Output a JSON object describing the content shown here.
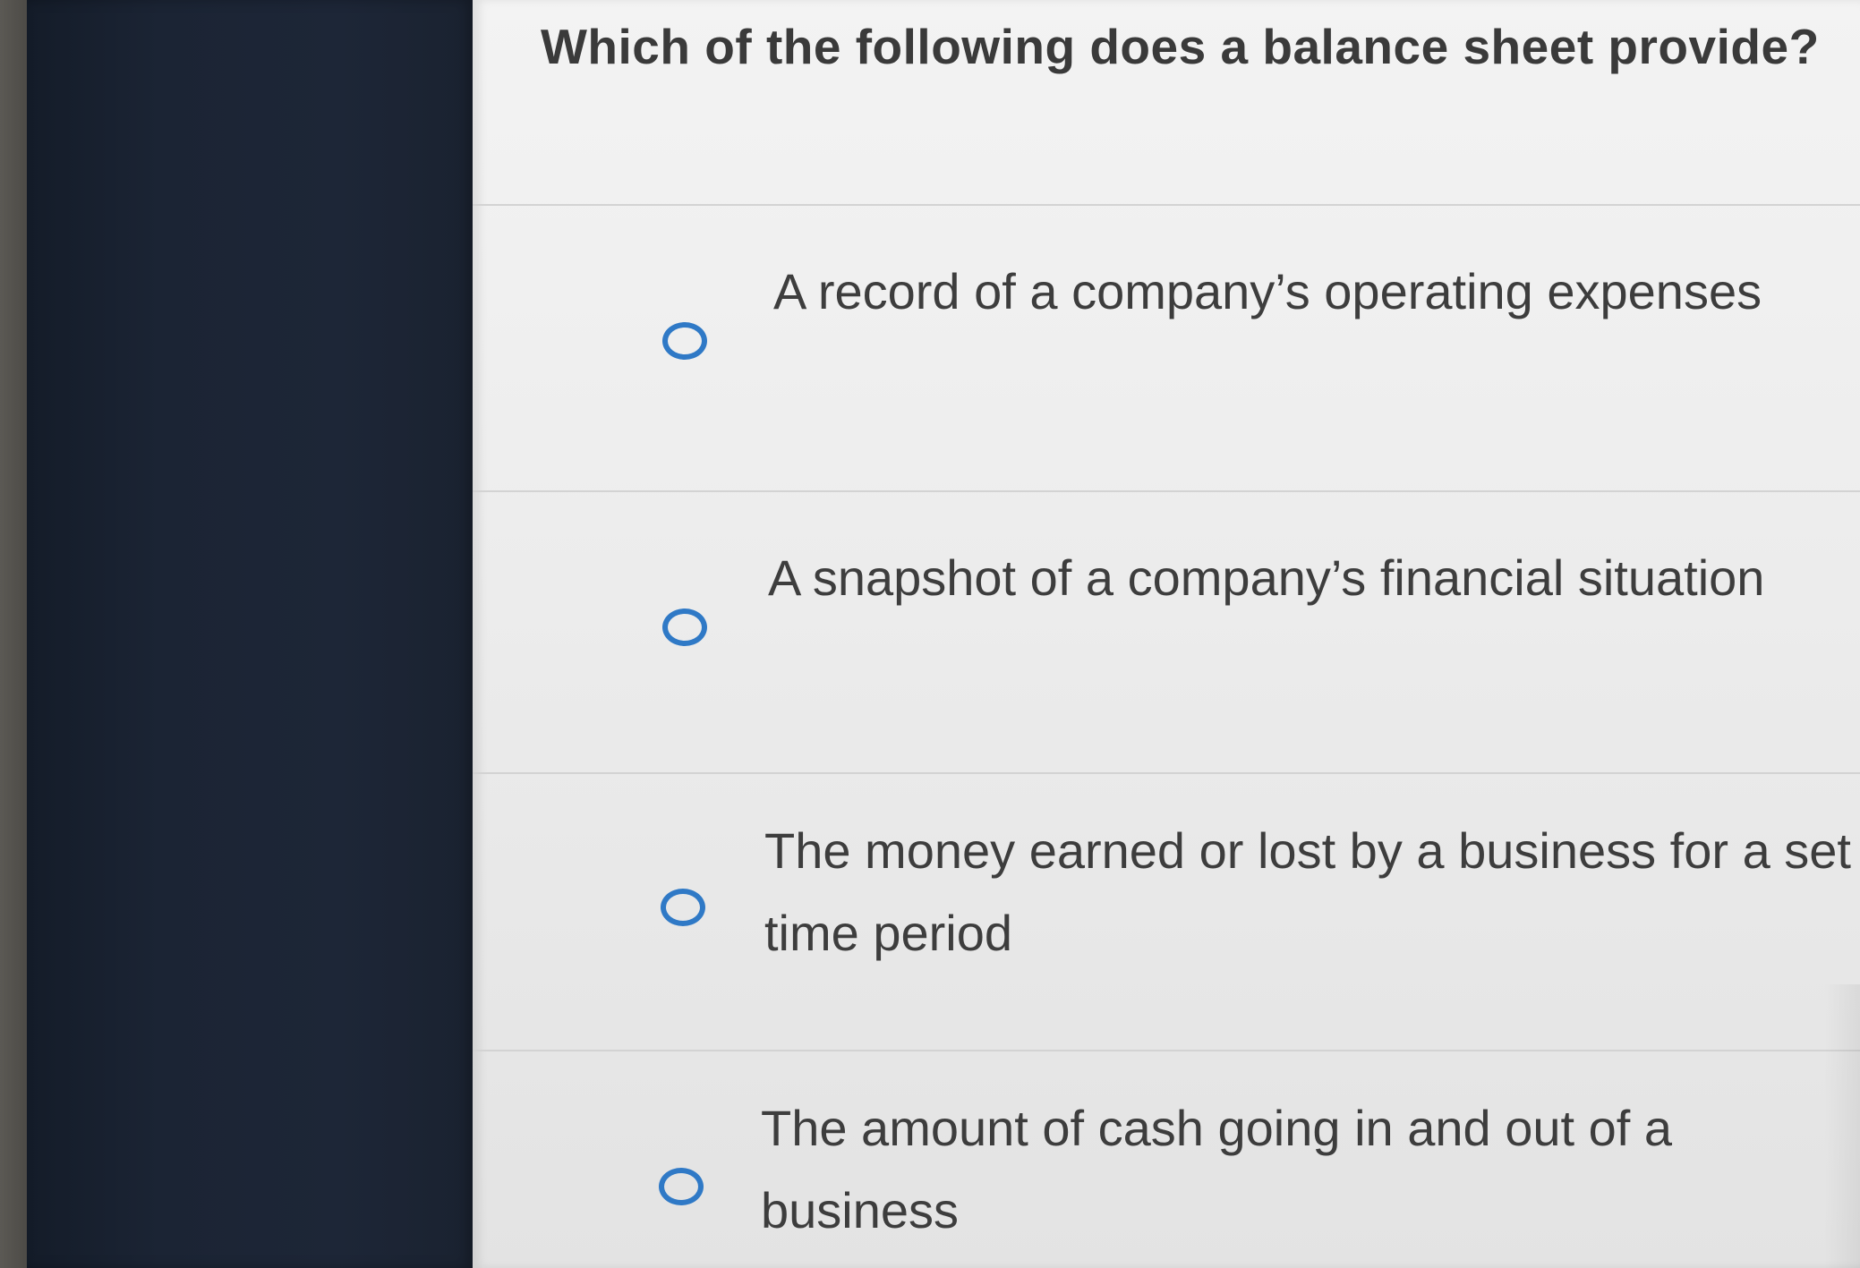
{
  "question": {
    "text": "Which of the following does a balance sheet provide?"
  },
  "options": [
    {
      "label": "A record of a company’s operating expenses",
      "selected": false
    },
    {
      "label": "A snapshot of a company’s financial situation",
      "selected": false
    },
    {
      "label": "The money earned or lost by a business for a set time period",
      "selected": false
    },
    {
      "label": "The amount of cash going in and out of a business",
      "selected": false
    }
  ],
  "colors": {
    "radio_accent": "#2f79c6",
    "sidebar": "#1d2637",
    "panel": "#eeeeee"
  },
  "icons": {
    "radio": "radio-unselected-icon"
  }
}
